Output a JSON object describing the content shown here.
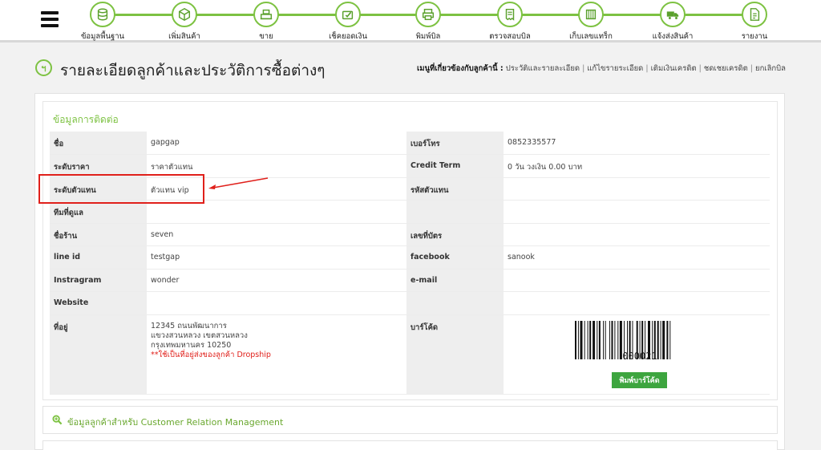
{
  "nav": {
    "items": [
      {
        "label": "ข้อมูลพื้นฐาน",
        "icon": "database-icon"
      },
      {
        "label": "เพิ่มสินค้า",
        "icon": "box-icon"
      },
      {
        "label": "ขาย",
        "icon": "cash-register-icon"
      },
      {
        "label": "เช็คยอดเงิน",
        "icon": "wallet-check-icon"
      },
      {
        "label": "พิมพ์บิล",
        "icon": "printer-icon"
      },
      {
        "label": "ตรวจสอบบิล",
        "icon": "bill-check-icon"
      },
      {
        "label": "เก็บเลขแทร็ก",
        "icon": "tracking-icon"
      },
      {
        "label": "แจ้งส่งสินค้า",
        "icon": "truck-icon"
      },
      {
        "label": "รายงาน",
        "icon": "report-icon"
      }
    ],
    "accent": "#7dc242"
  },
  "page": {
    "title": "รายละเอียดลูกค้าและประวัติการซื้อต่างๆ",
    "related_label": "เมนูที่เกี่ยวข้องกับลูกค้านี้ :",
    "related_links": [
      "ประวัติและรายละเอียด",
      "แก้ไขรายระเอียด",
      "เติมเงินเครดิต",
      "ชดเชยเครดิต",
      "ยกเลิกบิล"
    ]
  },
  "contact": {
    "section_title": "ข้อมูลการติดต่อ",
    "rows": [
      {
        "l1": "ชื่อ",
        "v1": "gapgap",
        "l2": "เบอร์โทร",
        "v2": "0852335577"
      },
      {
        "l1": "ระดับราคา",
        "v1": "ราคาตัวแทน",
        "l2": "Credit Term",
        "v2": "0 วัน วงเงิน 0.00 บาท"
      },
      {
        "l1": "ระดับตัวแทน",
        "v1": "ตัวแทน vip",
        "l2": "รหัสตัวแทน",
        "v2": ""
      },
      {
        "l1": "ทีมที่ดูแล",
        "v1": "",
        "l2": "",
        "v2": ""
      },
      {
        "l1": "ชื่อร้าน",
        "v1": "seven",
        "l2": "เลขที่บัตร",
        "v2": ""
      },
      {
        "l1": "line id",
        "v1": "testgap",
        "l2": "facebook",
        "v2": "sanook"
      },
      {
        "l1": "Instragram",
        "v1": "wonder",
        "l2": "e-mail",
        "v2": ""
      },
      {
        "l1": "Website",
        "v1": "",
        "l2": "",
        "v2": ""
      }
    ],
    "address_label": "ที่อยู่",
    "address_lines": [
      "12345 ถนนพัฒนาการ",
      "แขวงสวนหลวง เขตสวนหลวง",
      "กรุงเทพมหานคร 10250"
    ],
    "address_note": "**ใช้เป็นที่อยู่ส่งของลูกค้า Dropship",
    "barcode_label": "บาร์โค้ด",
    "barcode_value": "000021",
    "print_barcode_label": "พิมพ์บาร์โค้ด",
    "note_color": "#e0201b"
  },
  "crm": {
    "label": "ข้อมูลลูกค้าสำหรับ Customer Relation Management",
    "icon": "zoom-in-icon"
  }
}
